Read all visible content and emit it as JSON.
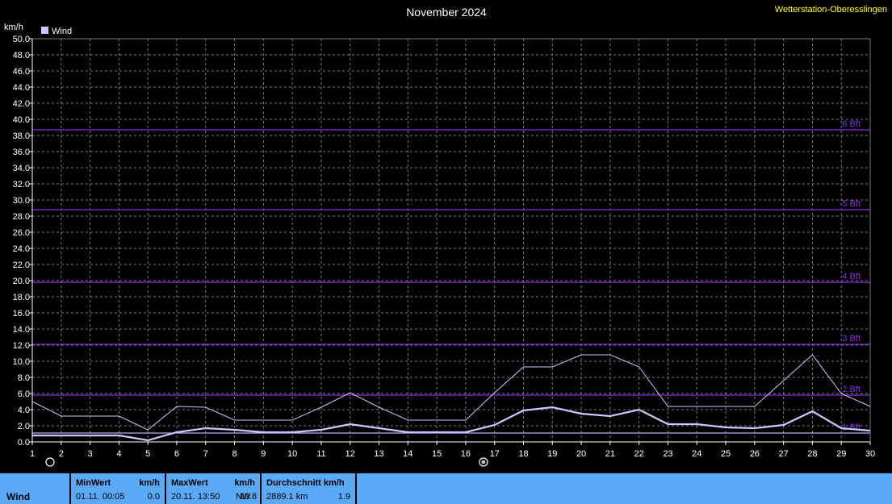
{
  "station": "Wetterstation-Oberesslingen",
  "chart_data": {
    "type": "line",
    "title": "November 2024",
    "ylabel": "km/h",
    "xlabel": "",
    "ylim": [
      0,
      50
    ],
    "y_tick_step": 2,
    "y_tick_labels": [
      "0.0",
      "2.0",
      "4.0",
      "6.0",
      "8.0",
      "10.0",
      "12.0",
      "14.0",
      "16.0",
      "18.0",
      "20.0",
      "22.0",
      "24.0",
      "26.0",
      "28.0",
      "30.0",
      "32.0",
      "34.0",
      "36.0",
      "38.0",
      "40.0",
      "42.0",
      "44.0",
      "46.0",
      "48.0",
      "50.0"
    ],
    "x": [
      1,
      2,
      3,
      4,
      5,
      6,
      7,
      8,
      9,
      10,
      11,
      12,
      13,
      14,
      15,
      16,
      17,
      18,
      19,
      20,
      21,
      22,
      23,
      24,
      25,
      26,
      27,
      28,
      29,
      30
    ],
    "x_tick_labels": [
      "1",
      "2",
      "3",
      "4",
      "5",
      "6",
      "7",
      "8",
      "9",
      "10",
      "11",
      "12",
      "13",
      "14",
      "15",
      "16",
      "17",
      "18",
      "19",
      "20",
      "21",
      "22",
      "23",
      "24",
      "25",
      "26",
      "27",
      "28",
      "29",
      "30"
    ],
    "grid": true,
    "legend": {
      "position": "top-left",
      "entries": [
        "Wind"
      ]
    },
    "series": [
      {
        "name": "Wind",
        "color": "#c8c8ff",
        "values": [
          0.8,
          0.8,
          0.8,
          0.8,
          0.2,
          1.2,
          1.7,
          1.5,
          1.2,
          1.2,
          1.5,
          2.2,
          1.7,
          1.2,
          1.2,
          1.2,
          2.1,
          3.9,
          4.3,
          3.5,
          3.2,
          4.0,
          2.2,
          2.2,
          1.8,
          1.7,
          2.1,
          3.8,
          1.7,
          1.4
        ]
      },
      {
        "color": "#c8c8ff",
        "values": [
          5.0,
          3.2,
          3.2,
          3.2,
          1.5,
          4.4,
          4.3,
          2.7,
          2.7,
          2.7,
          4.3,
          6.1,
          4.3,
          2.7,
          2.7,
          2.7,
          6.1,
          9.3,
          9.3,
          10.8,
          10.8,
          9.3,
          4.4,
          4.4,
          4.4,
          4.4,
          7.6,
          10.8,
          6.0,
          4.4
        ]
      },
      {
        "color": "#c8c8ff",
        "values": [
          1.1,
          1.1,
          1.1,
          1.1,
          1.1,
          1.1,
          1.1,
          1.1,
          1.1,
          1.1,
          1.1,
          1.1,
          1.1,
          1.1,
          1.1,
          1.1,
          1.1,
          1.1,
          1.1,
          1.1,
          1.1,
          1.1,
          1.1,
          1.1,
          1.1,
          1.1,
          1.1,
          1.1,
          1.1,
          1.1
        ]
      }
    ],
    "beaufort_lines": [
      {
        "label": "1 Bft",
        "value": 1.1
      },
      {
        "label": "2 Bft",
        "value": 5.8
      },
      {
        "label": "3 Bft",
        "value": 12.1
      },
      {
        "label": "4 Bft",
        "value": 19.8
      },
      {
        "label": "5 Bft",
        "value": 28.8
      },
      {
        "label": "6 Bft",
        "value": 38.7
      }
    ],
    "moon_phases": [
      {
        "day": 1,
        "icon": "new-moon-icon"
      },
      {
        "day": 16,
        "icon": "full-moon-icon"
      }
    ]
  },
  "stats": {
    "row_label": "Wind",
    "min": {
      "header": "MinWert",
      "unit": "km/h",
      "when": "01.11.  00:05",
      "value": "0.0"
    },
    "max": {
      "header": "MaxWert",
      "unit": "km/h",
      "when": "20.11.  13:50",
      "dir": "NW",
      "value": "10.8"
    },
    "avg": {
      "header": "Durchschnitt km/h",
      "distance": "2889.1 km",
      "value": "1.9"
    }
  },
  "colors": {
    "background": "#000000",
    "grid": "#7a7a7a",
    "axis": "#ffffff",
    "beaufort": "#8a2be2",
    "series": "#c8c8ff",
    "stats_bg": "#5aa9f7",
    "station": "#ffff00"
  }
}
